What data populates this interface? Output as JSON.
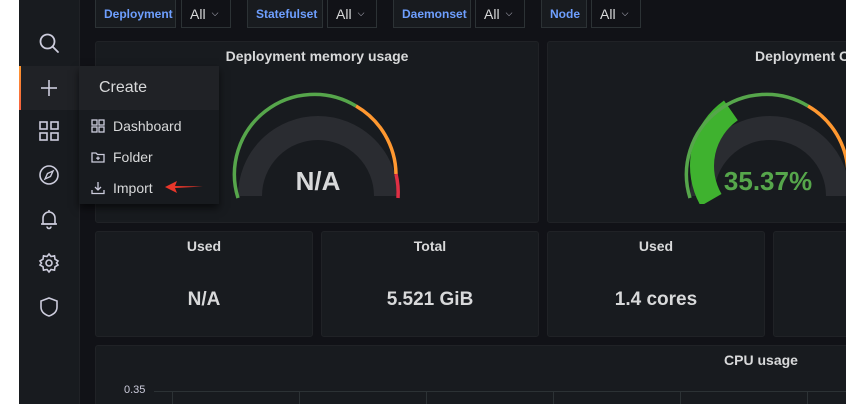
{
  "variables": [
    {
      "label": "Deployment",
      "value": "All"
    },
    {
      "label": "Statefulset",
      "value": "All"
    },
    {
      "label": "Daemonset",
      "value": "All"
    },
    {
      "label": "Node",
      "value": "All"
    }
  ],
  "sidebar": {
    "items": [
      "search-icon",
      "plus-icon",
      "dashboards-icon",
      "explore-icon",
      "alerting-icon",
      "configuration-icon",
      "server-admin-icon"
    ],
    "active": "plus-icon"
  },
  "create_menu": {
    "header": "Create",
    "items": [
      {
        "label": "Dashboard",
        "icon": "apps-icon"
      },
      {
        "label": "Folder",
        "icon": "folder-plus-icon"
      },
      {
        "label": "Import",
        "icon": "import-icon"
      }
    ]
  },
  "panels": {
    "memory_gauge": {
      "title": "Deployment memory usage",
      "value": "N/A"
    },
    "cpu_gauge": {
      "title": "Deployment CPU usage",
      "value": "35.37%",
      "fraction": 0.3537
    },
    "stat_used_memory": {
      "title": "Used",
      "value": "N/A"
    },
    "stat_total": {
      "title": "Total",
      "value": "5.521 GiB"
    },
    "stat_used_cores": {
      "title": "Used",
      "value": "1.4 cores"
    },
    "cpu_usage": {
      "title": "CPU usage",
      "ytick": "0.35"
    }
  },
  "colors": {
    "background": "#111217",
    "panel": "#181b1f",
    "green": "#56a64b",
    "orange": "#ff9830",
    "red": "#e02f44",
    "accent_text": "#6e9fff",
    "annotation_arrow": "#e8362a"
  }
}
